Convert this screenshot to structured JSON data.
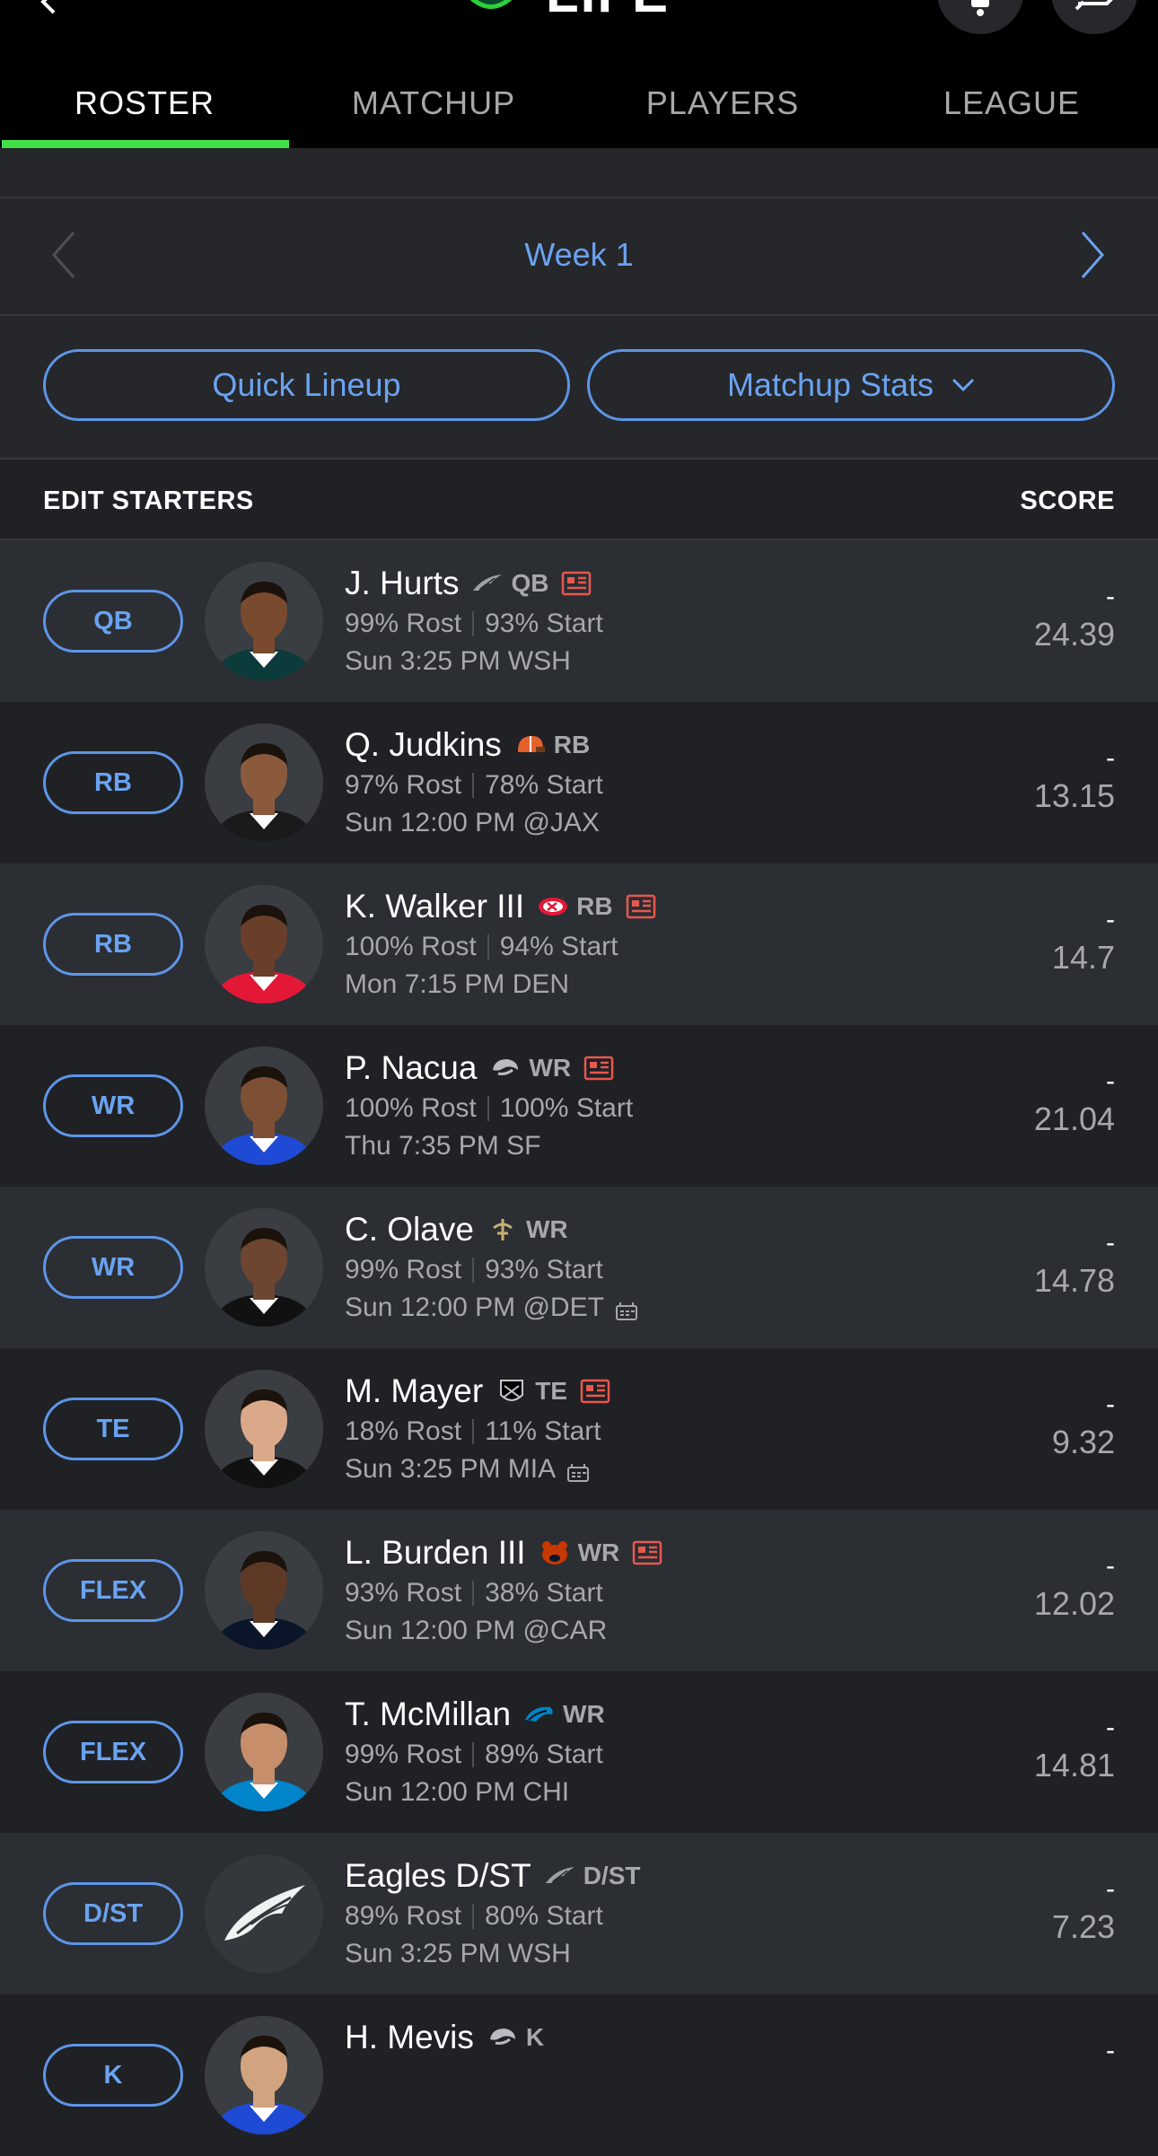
{
  "header": {
    "title_fragment": "LIFE"
  },
  "tabs": [
    {
      "label": "ROSTER",
      "active": true
    },
    {
      "label": "MATCHUP",
      "active": false
    },
    {
      "label": "PLAYERS",
      "active": false
    },
    {
      "label": "LEAGUE",
      "active": false
    }
  ],
  "week_nav": {
    "label": "Week 1"
  },
  "actions": {
    "quick_lineup": "Quick Lineup",
    "matchup_stats": "Matchup Stats"
  },
  "list_header": {
    "left": "EDIT STARTERS",
    "right": "SCORE"
  },
  "colors": {
    "accent": "#6aa3f0",
    "active_tab": "#3fe048",
    "news": "#e8584f"
  },
  "players": [
    {
      "slot": "QB",
      "name": "J. Hurts",
      "team_icon": "eagles-icon",
      "position": "QB",
      "news": true,
      "rost": "99% Rost",
      "start": "93% Start",
      "game": "Sun 3:25 PM WSH",
      "weather": false,
      "dash": "-",
      "score": "24.39"
    },
    {
      "slot": "RB",
      "name": "Q. Judkins",
      "team_icon": "browns-icon",
      "position": "RB",
      "news": false,
      "rost": "97% Rost",
      "start": "78% Start",
      "game": "Sun 12:00 PM @JAX",
      "weather": false,
      "dash": "-",
      "score": "13.15"
    },
    {
      "slot": "RB",
      "name": "K. Walker III",
      "team_icon": "chiefs-icon",
      "position": "RB",
      "news": true,
      "rost": "100% Rost",
      "start": "94% Start",
      "game": "Mon 7:15 PM DEN",
      "weather": false,
      "dash": "-",
      "score": "14.7"
    },
    {
      "slot": "WR",
      "name": "P. Nacua",
      "team_icon": "rams-icon",
      "position": "WR",
      "news": true,
      "rost": "100% Rost",
      "start": "100% Start",
      "game": "Thu 7:35 PM SF",
      "weather": false,
      "dash": "-",
      "score": "21.04"
    },
    {
      "slot": "WR",
      "name": "C. Olave",
      "team_icon": "saints-icon",
      "position": "WR",
      "news": false,
      "rost": "99% Rost",
      "start": "93% Start",
      "game": "Sun 12:00 PM @DET",
      "weather": true,
      "dash": "-",
      "score": "14.78"
    },
    {
      "slot": "TE",
      "name": "M. Mayer",
      "team_icon": "raiders-icon",
      "position": "TE",
      "news": true,
      "rost": "18% Rost",
      "start": "11% Start",
      "game": "Sun 3:25 PM MIA",
      "weather": true,
      "dash": "-",
      "score": "9.32"
    },
    {
      "slot": "FLEX",
      "name": "L. Burden III",
      "team_icon": "bears-icon",
      "position": "WR",
      "news": true,
      "rost": "93% Rost",
      "start": "38% Start",
      "game": "Sun 12:00 PM @CAR",
      "weather": false,
      "dash": "-",
      "score": "12.02"
    },
    {
      "slot": "FLEX",
      "name": "T. McMillan",
      "team_icon": "panthers-icon",
      "position": "WR",
      "news": false,
      "rost": "99% Rost",
      "start": "89% Start",
      "game": "Sun 12:00 PM CHI",
      "weather": false,
      "dash": "-",
      "score": "14.81"
    },
    {
      "slot": "D/ST",
      "name": "Eagles D/ST",
      "team_icon": "eagles-icon",
      "position": "D/ST",
      "news": false,
      "rost": "89% Rost",
      "start": "80% Start",
      "game": "Sun 3:25 PM WSH",
      "weather": false,
      "dash": "-",
      "score": "7.23"
    },
    {
      "slot": "K",
      "name": "H. Mevis",
      "team_icon": "rams-icon",
      "position": "K",
      "news": false,
      "rost": "",
      "start": "",
      "game": "",
      "weather": false,
      "dash": "-",
      "score": ""
    }
  ]
}
